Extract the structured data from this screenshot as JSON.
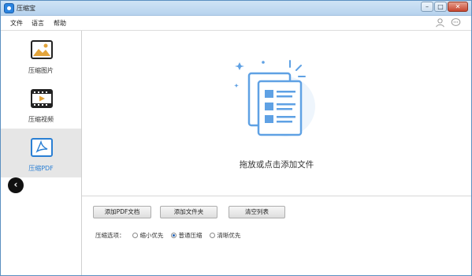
{
  "window": {
    "title": "压缩宝"
  },
  "menu": {
    "file": "文件",
    "language": "语言",
    "help": "帮助"
  },
  "sidebar": {
    "items": [
      {
        "label": "压缩图片",
        "icon": "image-icon",
        "active": false
      },
      {
        "label": "压缩视频",
        "icon": "video-icon",
        "active": false
      },
      {
        "label": "压缩PDF",
        "icon": "pdf-icon",
        "active": true
      }
    ],
    "collapse_icon": "chevron-left-icon"
  },
  "drop_area": {
    "text": "拖放或点击添加文件",
    "icon": "add-documents-icon"
  },
  "toolbar": {
    "add_pdf": "添加PDF文档",
    "add_folder": "添加文件夹",
    "clear_list": "清空列表"
  },
  "compression": {
    "label": "压缩选项：",
    "options": [
      {
        "label": "缩小优先",
        "checked": false
      },
      {
        "label": "普通压缩",
        "checked": true
      },
      {
        "label": "清晰优先",
        "checked": false
      }
    ]
  },
  "colors": {
    "accent": "#2a7fd4",
    "active_bg": "#e6e6e6",
    "titlebar": "#b7d3ee"
  }
}
